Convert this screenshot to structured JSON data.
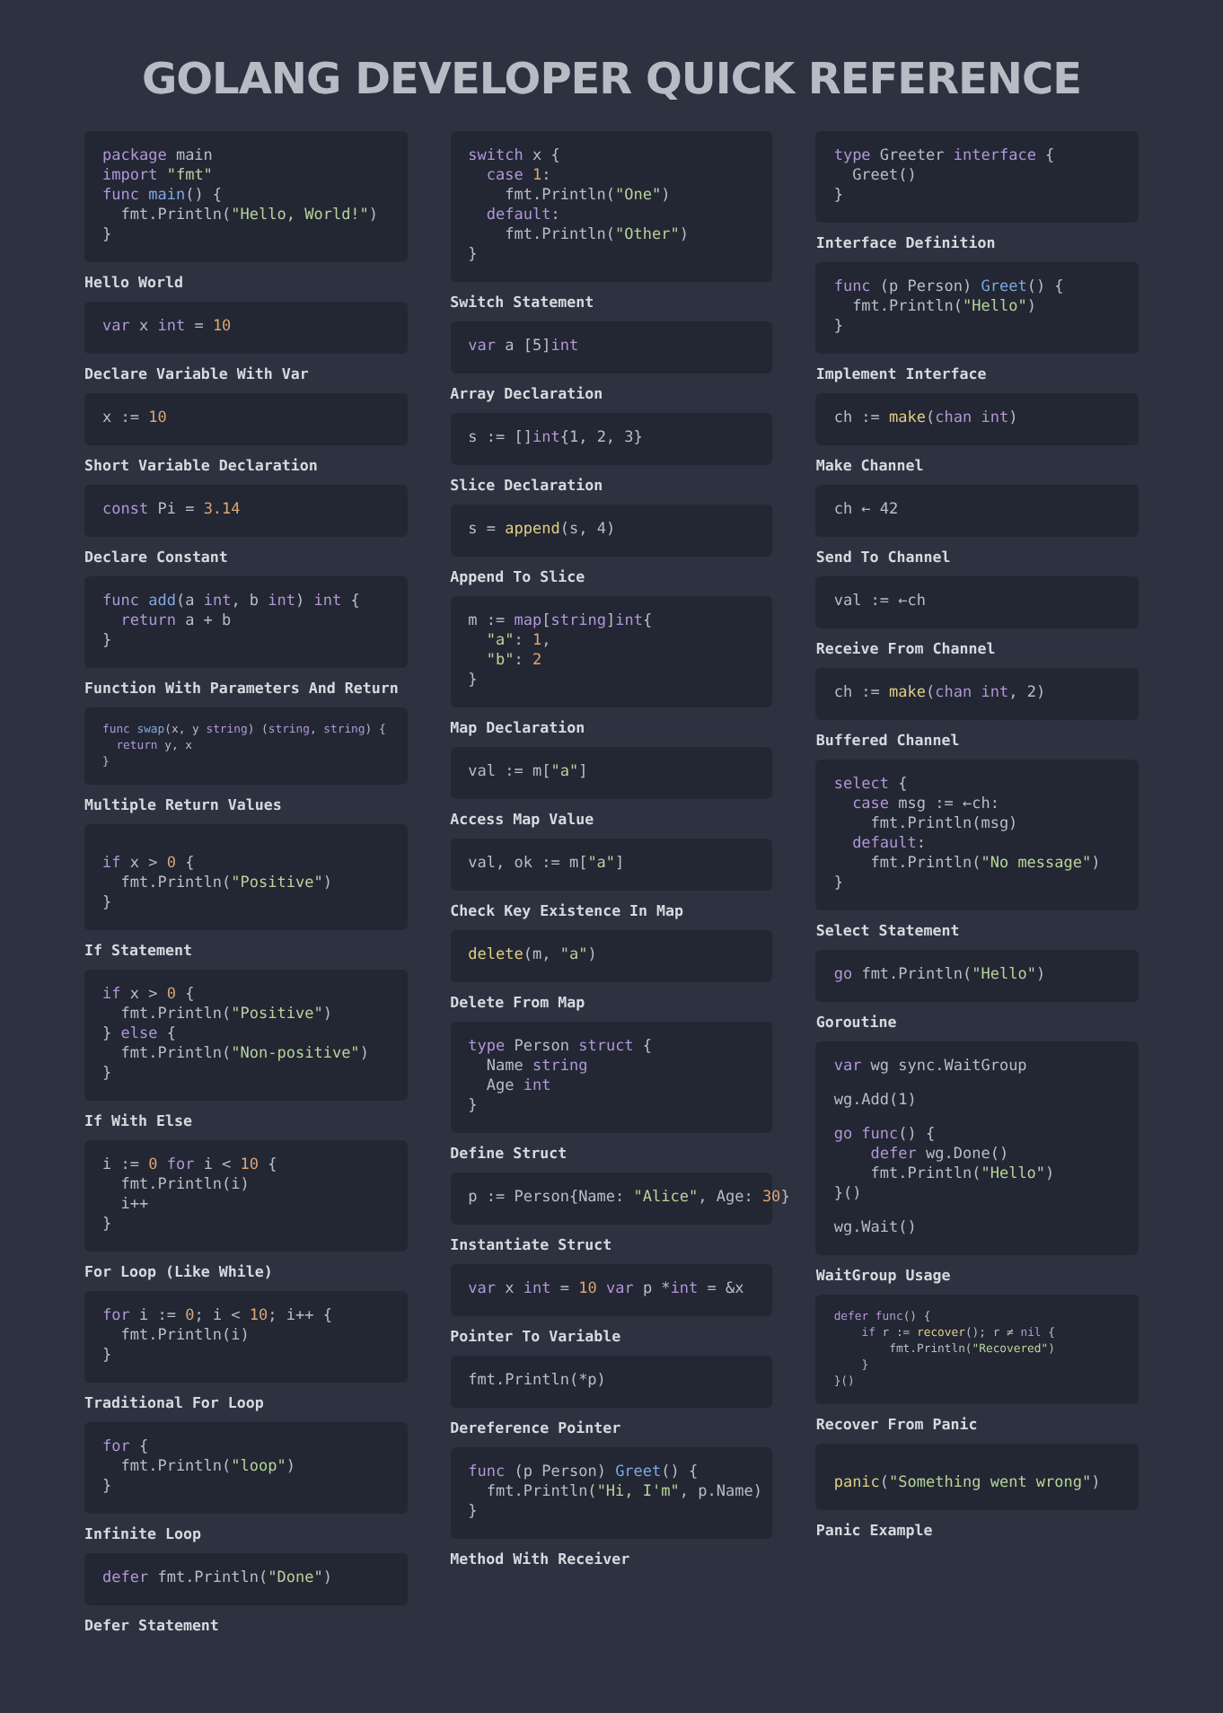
{
  "title": "GOLANG DEVELOPER QUICK REFERENCE",
  "columns": [
    {
      "snippets": [
        {
          "kind": "regular",
          "label": "Hello World",
          "lines": [
            [
              {
                "kind": "keyword",
                "text": "package"
              },
              {
                "kind": "plain",
                "text": " main"
              }
            ],
            [
              {
                "kind": "keyword",
                "text": "import"
              },
              {
                "kind": "string",
                "text": " \"fmt\""
              }
            ],
            [
              {
                "kind": "keyword",
                "text": "func"
              },
              {
                "kind": "function",
                "text": " main"
              },
              {
                "kind": "plain",
                "text": "() {"
              }
            ],
            [
              {
                "kind": "plain",
                "text": "  fmt.Println("
              },
              {
                "kind": "string",
                "text": "\"Hello, World!\""
              },
              {
                "kind": "plain",
                "text": ")"
              }
            ],
            [
              {
                "kind": "plain",
                "text": "}"
              }
            ]
          ]
        },
        {
          "kind": "regular",
          "label": "Declare Variable With Var",
          "lines": [
            [
              {
                "kind": "keyword",
                "text": "var"
              },
              {
                "kind": "plain",
                "text": " x "
              },
              {
                "kind": "keyword",
                "text": "int"
              },
              {
                "kind": "plain",
                "text": " = "
              },
              {
                "kind": "number",
                "text": "10"
              }
            ]
          ]
        },
        {
          "kind": "regular",
          "label": "Short Variable Declaration",
          "lines": [
            [
              {
                "kind": "plain",
                "text": "x := "
              },
              {
                "kind": "number",
                "text": "10"
              }
            ]
          ]
        },
        {
          "kind": "regular",
          "label": "Declare Constant",
          "lines": [
            [
              {
                "kind": "keyword",
                "text": "const"
              },
              {
                "kind": "plain",
                "text": " Pi = "
              },
              {
                "kind": "number",
                "text": "3.14"
              }
            ]
          ]
        },
        {
          "kind": "regular",
          "label": "Function With Parameters And Return",
          "lines": [
            [
              {
                "kind": "keyword",
                "text": "func"
              },
              {
                "kind": "function",
                "text": " add"
              },
              {
                "kind": "plain",
                "text": "(a "
              },
              {
                "kind": "keyword",
                "text": "int"
              },
              {
                "kind": "plain",
                "text": ", b "
              },
              {
                "kind": "keyword",
                "text": "int"
              },
              {
                "kind": "plain",
                "text": ") "
              },
              {
                "kind": "keyword",
                "text": "int"
              },
              {
                "kind": "plain",
                "text": " {"
              }
            ],
            [
              {
                "kind": "keyword",
                "text": "  return"
              },
              {
                "kind": "plain",
                "text": " a + b"
              }
            ],
            [
              {
                "kind": "plain",
                "text": "}"
              }
            ]
          ]
        },
        {
          "kind": "compact",
          "label": "Multiple Return Values",
          "lines": [
            [
              {
                "kind": "keyword",
                "text": "func"
              },
              {
                "kind": "function",
                "text": " swap"
              },
              {
                "kind": "plain",
                "text": "(x, y "
              },
              {
                "kind": "keyword",
                "text": "string"
              },
              {
                "kind": "plain",
                "text": ") ("
              },
              {
                "kind": "keyword",
                "text": "string"
              },
              {
                "kind": "plain",
                "text": ", "
              },
              {
                "kind": "keyword",
                "text": "string"
              },
              {
                "kind": "plain",
                "text": ") {"
              }
            ],
            [
              {
                "kind": "keyword",
                "text": "  return"
              },
              {
                "kind": "plain",
                "text": " y, x"
              }
            ],
            [
              {
                "kind": "plain",
                "text": "}"
              }
            ]
          ]
        },
        {
          "kind": "regular",
          "label": "If Statement",
          "lines": [
            {
              "kind": "gap"
            },
            [
              {
                "kind": "keyword",
                "text": "if"
              },
              {
                "kind": "plain",
                "text": " x > "
              },
              {
                "kind": "number",
                "text": "0"
              },
              {
                "kind": "plain",
                "text": " {"
              }
            ],
            [
              {
                "kind": "plain",
                "text": "  fmt.Println("
              },
              {
                "kind": "string",
                "text": "\"Positive\""
              },
              {
                "kind": "plain",
                "text": ")"
              }
            ],
            [
              {
                "kind": "plain",
                "text": "}"
              }
            ]
          ]
        },
        {
          "kind": "regular",
          "label": "If With Else",
          "lines": [
            [
              {
                "kind": "keyword",
                "text": "if"
              },
              {
                "kind": "plain",
                "text": " x > "
              },
              {
                "kind": "number",
                "text": "0"
              },
              {
                "kind": "plain",
                "text": " {"
              }
            ],
            [
              {
                "kind": "plain",
                "text": "  fmt.Println("
              },
              {
                "kind": "string",
                "text": "\"Positive\""
              },
              {
                "kind": "plain",
                "text": ")"
              }
            ],
            [
              {
                "kind": "plain",
                "text": "} "
              },
              {
                "kind": "keyword",
                "text": "else"
              },
              {
                "kind": "plain",
                "text": " {"
              }
            ],
            [
              {
                "kind": "plain",
                "text": "  fmt.Println("
              },
              {
                "kind": "string",
                "text": "\"Non-positive\""
              },
              {
                "kind": "plain",
                "text": ")"
              }
            ],
            [
              {
                "kind": "plain",
                "text": "}"
              }
            ]
          ]
        },
        {
          "kind": "regular",
          "label": "For Loop (Like While)",
          "lines": [
            [
              {
                "kind": "plain",
                "text": "i := "
              },
              {
                "kind": "number",
                "text": "0"
              },
              {
                "kind": "keyword",
                "text": " for"
              },
              {
                "kind": "plain",
                "text": " i < "
              },
              {
                "kind": "number",
                "text": "10"
              },
              {
                "kind": "plain",
                "text": " {"
              }
            ],
            [
              {
                "kind": "plain",
                "text": "  fmt.Println(i)"
              }
            ],
            [
              {
                "kind": "plain",
                "text": "  i++"
              }
            ],
            [
              {
                "kind": "plain",
                "text": "}"
              }
            ]
          ]
        },
        {
          "kind": "regular",
          "label": "Traditional For Loop",
          "lines": [
            [
              {
                "kind": "keyword",
                "text": "for"
              },
              {
                "kind": "plain",
                "text": " i := "
              },
              {
                "kind": "number",
                "text": "0"
              },
              {
                "kind": "plain",
                "text": "; i < "
              },
              {
                "kind": "number",
                "text": "10"
              },
              {
                "kind": "plain",
                "text": "; i++ {"
              }
            ],
            [
              {
                "kind": "plain",
                "text": "  fmt.Println(i)"
              }
            ],
            [
              {
                "kind": "plain",
                "text": "}"
              }
            ]
          ]
        },
        {
          "kind": "regular",
          "label": "Infinite Loop",
          "lines": [
            [
              {
                "kind": "keyword",
                "text": "for"
              },
              {
                "kind": "plain",
                "text": " {"
              }
            ],
            [
              {
                "kind": "plain",
                "text": "  fmt.Println("
              },
              {
                "kind": "string",
                "text": "\"loop\""
              },
              {
                "kind": "plain",
                "text": ")"
              }
            ],
            [
              {
                "kind": "plain",
                "text": "}"
              }
            ]
          ]
        },
        {
          "kind": "regular",
          "label": "Defer Statement",
          "lines": [
            [
              {
                "kind": "keyword",
                "text": "defer"
              },
              {
                "kind": "plain",
                "text": " fmt.Println("
              },
              {
                "kind": "string",
                "text": "\"Done\""
              },
              {
                "kind": "plain",
                "text": ")"
              }
            ]
          ]
        }
      ]
    },
    {
      "snippets": [
        {
          "kind": "regular",
          "label": "Switch Statement",
          "lines": [
            [
              {
                "kind": "keyword",
                "text": "switch"
              },
              {
                "kind": "plain",
                "text": " x {"
              }
            ],
            [
              {
                "kind": "keyword",
                "text": "  case"
              },
              {
                "kind": "number",
                "text": " 1"
              },
              {
                "kind": "plain",
                "text": ":"
              }
            ],
            [
              {
                "kind": "plain",
                "text": "    fmt.Println("
              },
              {
                "kind": "string",
                "text": "\"One\""
              },
              {
                "kind": "plain",
                "text": ")"
              }
            ],
            [
              {
                "kind": "keyword",
                "text": "  default"
              },
              {
                "kind": "plain",
                "text": ":"
              }
            ],
            [
              {
                "kind": "plain",
                "text": "    fmt.Println("
              },
              {
                "kind": "string",
                "text": "\"Other\""
              },
              {
                "kind": "plain",
                "text": ")"
              }
            ],
            [
              {
                "kind": "plain",
                "text": "}"
              }
            ]
          ]
        },
        {
          "kind": "regular",
          "label": "Array Declaration",
          "lines": [
            [
              {
                "kind": "keyword",
                "text": "var"
              },
              {
                "kind": "plain",
                "text": " a [5]"
              },
              {
                "kind": "keyword",
                "text": "int"
              }
            ]
          ]
        },
        {
          "kind": "regular",
          "label": "Slice Declaration",
          "lines": [
            [
              {
                "kind": "plain",
                "text": "s := []"
              },
              {
                "kind": "keyword",
                "text": "int"
              },
              {
                "kind": "plain",
                "text": "{1, 2, 3}"
              }
            ]
          ]
        },
        {
          "kind": "regular",
          "label": "Append To Slice",
          "lines": [
            [
              {
                "kind": "plain",
                "text": "s = "
              },
              {
                "kind": "builtin",
                "text": "append"
              },
              {
                "kind": "plain",
                "text": "(s, 4)"
              }
            ]
          ]
        },
        {
          "kind": "regular",
          "label": "Map Declaration",
          "lines": [
            [
              {
                "kind": "plain",
                "text": "m := "
              },
              {
                "kind": "keyword",
                "text": "map"
              },
              {
                "kind": "plain",
                "text": "["
              },
              {
                "kind": "keyword",
                "text": "string"
              },
              {
                "kind": "plain",
                "text": "]"
              },
              {
                "kind": "keyword",
                "text": "int"
              },
              {
                "kind": "plain",
                "text": "{"
              }
            ],
            [
              {
                "kind": "string",
                "text": "  \"a\""
              },
              {
                "kind": "plain",
                "text": ": "
              },
              {
                "kind": "number",
                "text": "1"
              },
              {
                "kind": "plain",
                "text": ","
              }
            ],
            [
              {
                "kind": "string",
                "text": "  \"b\""
              },
              {
                "kind": "plain",
                "text": ": "
              },
              {
                "kind": "number",
                "text": "2"
              }
            ],
            [
              {
                "kind": "plain",
                "text": "}"
              }
            ]
          ]
        },
        {
          "kind": "regular",
          "label": "Access Map Value",
          "lines": [
            [
              {
                "kind": "plain",
                "text": "val := m["
              },
              {
                "kind": "string",
                "text": "\"a\""
              },
              {
                "kind": "plain",
                "text": "]"
              }
            ]
          ]
        },
        {
          "kind": "regular",
          "label": "Check Key Existence In Map",
          "lines": [
            [
              {
                "kind": "plain",
                "text": "val, ok := m["
              },
              {
                "kind": "string",
                "text": "\"a\""
              },
              {
                "kind": "plain",
                "text": "]"
              }
            ]
          ]
        },
        {
          "kind": "regular",
          "label": "Delete From Map",
          "lines": [
            [
              {
                "kind": "builtin",
                "text": "delete"
              },
              {
                "kind": "plain",
                "text": "(m, "
              },
              {
                "kind": "string",
                "text": "\"a\""
              },
              {
                "kind": "plain",
                "text": ")"
              }
            ]
          ]
        },
        {
          "kind": "regular",
          "label": "Define Struct",
          "lines": [
            [
              {
                "kind": "keyword",
                "text": "type"
              },
              {
                "kind": "plain",
                "text": " Person "
              },
              {
                "kind": "keyword",
                "text": "struct"
              },
              {
                "kind": "plain",
                "text": " {"
              }
            ],
            [
              {
                "kind": "plain",
                "text": "  Name "
              },
              {
                "kind": "keyword",
                "text": "string"
              }
            ],
            [
              {
                "kind": "plain",
                "text": "  Age "
              },
              {
                "kind": "keyword",
                "text": "int"
              }
            ],
            [
              {
                "kind": "plain",
                "text": "}"
              }
            ]
          ]
        },
        {
          "kind": "regular",
          "label": "Instantiate Struct",
          "lines": [
            [
              {
                "kind": "plain",
                "text": "p := Person{Name: "
              },
              {
                "kind": "string",
                "text": "\"Alice\""
              },
              {
                "kind": "plain",
                "text": ", Age: "
              },
              {
                "kind": "number",
                "text": "30"
              },
              {
                "kind": "plain",
                "text": "}"
              }
            ]
          ]
        },
        {
          "kind": "regular",
          "label": "Pointer To Variable",
          "lines": [
            [
              {
                "kind": "keyword",
                "text": "var"
              },
              {
                "kind": "plain",
                "text": " x "
              },
              {
                "kind": "keyword",
                "text": "int"
              },
              {
                "kind": "plain",
                "text": " = "
              },
              {
                "kind": "number",
                "text": "10"
              },
              {
                "kind": "keyword",
                "text": " var"
              },
              {
                "kind": "plain",
                "text": " p *"
              },
              {
                "kind": "keyword",
                "text": "int"
              },
              {
                "kind": "plain",
                "text": " = &x"
              }
            ]
          ]
        },
        {
          "kind": "regular",
          "label": "Dereference Pointer",
          "lines": [
            [
              {
                "kind": "plain",
                "text": "fmt.Println(*p)"
              }
            ]
          ]
        },
        {
          "kind": "regular",
          "label": "Method With Receiver",
          "lines": [
            [
              {
                "kind": "keyword",
                "text": "func"
              },
              {
                "kind": "plain",
                "text": " (p Person) "
              },
              {
                "kind": "function",
                "text": "Greet"
              },
              {
                "kind": "plain",
                "text": "() {"
              }
            ],
            [
              {
                "kind": "plain",
                "text": "  fmt.Println("
              },
              {
                "kind": "string",
                "text": "\"Hi, I'm\""
              },
              {
                "kind": "plain",
                "text": ", p.Name)"
              }
            ],
            [
              {
                "kind": "plain",
                "text": "}"
              }
            ]
          ]
        }
      ]
    },
    {
      "snippets": [
        {
          "kind": "regular",
          "label": "Interface Definition",
          "lines": [
            [
              {
                "kind": "keyword",
                "text": "type"
              },
              {
                "kind": "plain",
                "text": " Greeter "
              },
              {
                "kind": "keyword",
                "text": "interface"
              },
              {
                "kind": "plain",
                "text": " {"
              }
            ],
            [
              {
                "kind": "plain",
                "text": "  Greet()"
              }
            ],
            [
              {
                "kind": "plain",
                "text": "}"
              }
            ]
          ]
        },
        {
          "kind": "regular",
          "label": "Implement Interface",
          "lines": [
            [
              {
                "kind": "keyword",
                "text": "func"
              },
              {
                "kind": "plain",
                "text": " (p Person) "
              },
              {
                "kind": "function",
                "text": "Greet"
              },
              {
                "kind": "plain",
                "text": "() {"
              }
            ],
            [
              {
                "kind": "plain",
                "text": "  fmt.Println("
              },
              {
                "kind": "string",
                "text": "\"Hello\""
              },
              {
                "kind": "plain",
                "text": ")"
              }
            ],
            [
              {
                "kind": "plain",
                "text": "}"
              }
            ]
          ]
        },
        {
          "kind": "regular",
          "label": "Make Channel",
          "lines": [
            [
              {
                "kind": "plain",
                "text": "ch := "
              },
              {
                "kind": "builtin",
                "text": "make"
              },
              {
                "kind": "plain",
                "text": "("
              },
              {
                "kind": "keyword",
                "text": "chan int"
              },
              {
                "kind": "plain",
                "text": ")"
              }
            ]
          ]
        },
        {
          "kind": "regular",
          "label": "Send To Channel",
          "lines": [
            [
              {
                "kind": "plain",
                "text": "ch ← 42"
              }
            ]
          ]
        },
        {
          "kind": "regular",
          "label": "Receive From Channel",
          "lines": [
            [
              {
                "kind": "plain",
                "text": "val := ←ch"
              }
            ]
          ]
        },
        {
          "kind": "regular",
          "label": "Buffered Channel",
          "lines": [
            [
              {
                "kind": "plain",
                "text": "ch := "
              },
              {
                "kind": "builtin",
                "text": "make"
              },
              {
                "kind": "plain",
                "text": "("
              },
              {
                "kind": "keyword",
                "text": "chan int"
              },
              {
                "kind": "plain",
                "text": ", 2)"
              }
            ]
          ]
        },
        {
          "kind": "regular",
          "label": "Select Statement",
          "lines": [
            [
              {
                "kind": "keyword",
                "text": "select"
              },
              {
                "kind": "plain",
                "text": " {"
              }
            ],
            [
              {
                "kind": "keyword",
                "text": "  case"
              },
              {
                "kind": "plain",
                "text": " msg := ←ch:"
              }
            ],
            [
              {
                "kind": "plain",
                "text": "    fmt.Println(msg)"
              }
            ],
            [
              {
                "kind": "keyword",
                "text": "  default"
              },
              {
                "kind": "plain",
                "text": ":"
              }
            ],
            [
              {
                "kind": "plain",
                "text": "    fmt.Println("
              },
              {
                "kind": "string",
                "text": "\"No message\""
              },
              {
                "kind": "plain",
                "text": ")"
              }
            ],
            [
              {
                "kind": "plain",
                "text": "}"
              }
            ]
          ]
        },
        {
          "kind": "regular",
          "label": "Goroutine",
          "lines": [
            [
              {
                "kind": "keyword",
                "text": "go"
              },
              {
                "kind": "plain",
                "text": " fmt.Println("
              },
              {
                "kind": "string",
                "text": "\"Hello\""
              },
              {
                "kind": "plain",
                "text": ")"
              }
            ]
          ]
        },
        {
          "kind": "regular",
          "label": "WaitGroup Usage",
          "lines": [
            [
              {
                "kind": "keyword",
                "text": "var"
              },
              {
                "kind": "plain",
                "text": " wg sync.WaitGroup"
              }
            ],
            {
              "kind": "gap"
            },
            [
              {
                "kind": "plain",
                "text": "wg.Add(1)"
              }
            ],
            {
              "kind": "gap"
            },
            [
              {
                "kind": "keyword",
                "text": "go func"
              },
              {
                "kind": "plain",
                "text": "() {"
              }
            ],
            [
              {
                "kind": "keyword",
                "text": "    defer"
              },
              {
                "kind": "plain",
                "text": " wg.Done()"
              }
            ],
            [
              {
                "kind": "plain",
                "text": "    fmt.Println("
              },
              {
                "kind": "string",
                "text": "\"Hello\""
              },
              {
                "kind": "plain",
                "text": ")"
              }
            ],
            [
              {
                "kind": "plain",
                "text": "}()"
              }
            ],
            {
              "kind": "gap"
            },
            [
              {
                "kind": "plain",
                "text": "wg.Wait()"
              }
            ]
          ]
        },
        {
          "kind": "compact",
          "label": "Recover From Panic",
          "lines": [
            [
              {
                "kind": "keyword",
                "text": "defer func"
              },
              {
                "kind": "plain",
                "text": "() {"
              }
            ],
            [
              {
                "kind": "keyword",
                "text": "    if"
              },
              {
                "kind": "plain",
                "text": " r := "
              },
              {
                "kind": "builtin",
                "text": "recover"
              },
              {
                "kind": "plain",
                "text": "(); r ≠ "
              },
              {
                "kind": "keyword",
                "text": "nil"
              },
              {
                "kind": "plain",
                "text": " {"
              }
            ],
            [
              {
                "kind": "plain",
                "text": "        fmt.Println("
              },
              {
                "kind": "string",
                "text": "\"Recovered\""
              },
              {
                "kind": "plain",
                "text": ")"
              }
            ],
            [
              {
                "kind": "plain",
                "text": "    }"
              }
            ],
            [
              {
                "kind": "plain",
                "text": "}()"
              }
            ]
          ]
        },
        {
          "kind": "regular",
          "label": "Panic Example",
          "lines": [
            {
              "kind": "gap"
            },
            [
              {
                "kind": "builtin",
                "text": "panic"
              },
              {
                "kind": "plain",
                "text": "("
              },
              {
                "kind": "string",
                "text": "\"Something went wrong\""
              },
              {
                "kind": "plain",
                "text": ")"
              }
            ]
          ]
        }
      ]
    }
  ]
}
